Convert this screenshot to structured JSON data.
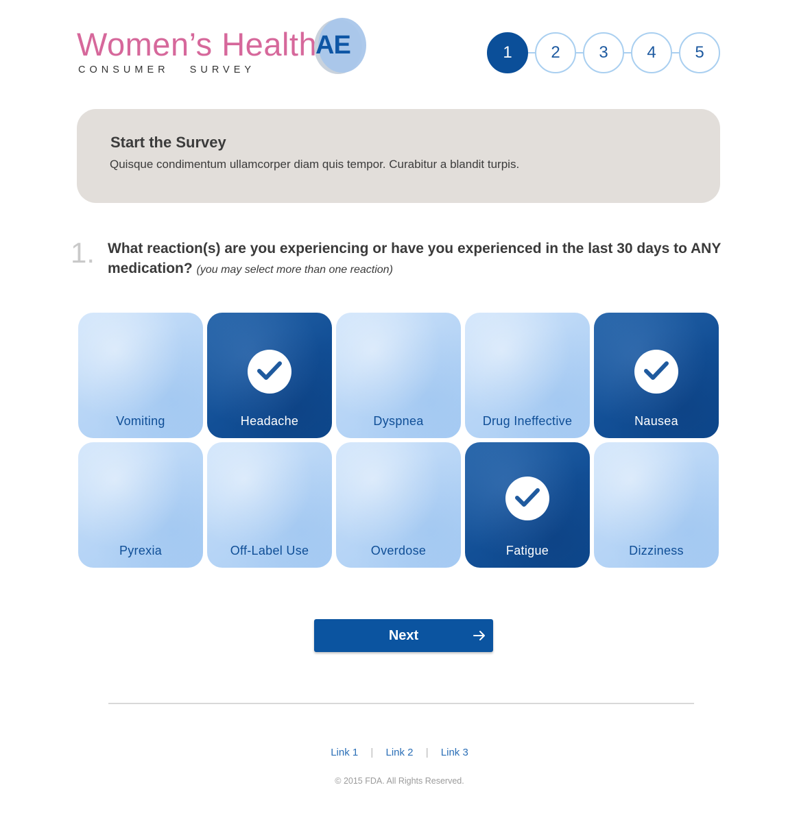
{
  "brand": {
    "title": "Women’s Health",
    "badge": "AE",
    "subtitle": "CONSUMER   SURVEY",
    "title_color": "#d6689b",
    "accent": "#0b54a0"
  },
  "steps": {
    "items": [
      "1",
      "2",
      "3",
      "4",
      "5"
    ],
    "current": "1"
  },
  "intro": {
    "title": "Start the Survey",
    "text": "Quisque condimentum ullamcorper diam quis tempor. Curabitur a blandit turpis."
  },
  "question": {
    "number": "1.",
    "text": "What reaction(s) are you experiencing or have you experienced in the last 30 days to ANY medication?",
    "hint": "(you may select more than one reaction)"
  },
  "reactions": [
    {
      "label": "Vomiting",
      "selected": false
    },
    {
      "label": "Headache",
      "selected": true
    },
    {
      "label": "Dyspnea",
      "selected": false
    },
    {
      "label": "Drug Ineffective",
      "selected": false
    },
    {
      "label": "Nausea",
      "selected": true
    },
    {
      "label": "Pyrexia",
      "selected": false
    },
    {
      "label": "Off-Label Use",
      "selected": false
    },
    {
      "label": "Overdose",
      "selected": false
    },
    {
      "label": "Fatigue",
      "selected": true
    },
    {
      "label": "Dizziness",
      "selected": false
    }
  ],
  "actions": {
    "next_label": "Next"
  },
  "footer": {
    "links": [
      "Link 1",
      "Link 2",
      "Link 3"
    ],
    "separator": "|",
    "copyright": "© 2015 FDA. All Rights Reserved."
  }
}
